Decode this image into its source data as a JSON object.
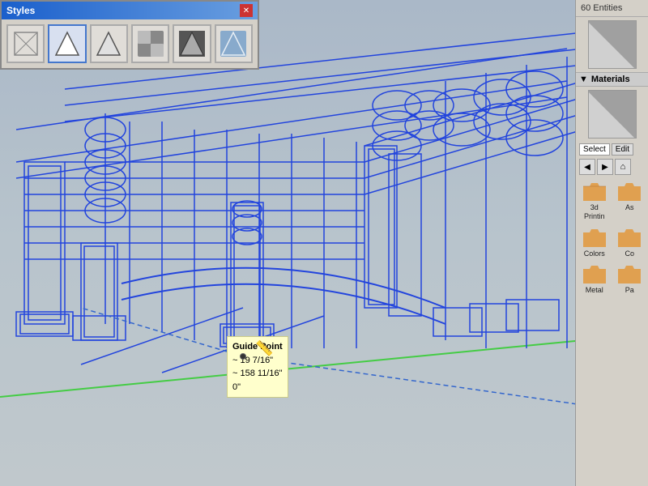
{
  "styles_dialog": {
    "title": "Styles",
    "close_label": "✕",
    "style_buttons": [
      {
        "id": "wireframe",
        "label": "Wireframe",
        "active": false
      },
      {
        "id": "hidden-line",
        "label": "Hidden Line",
        "active": true
      },
      {
        "id": "shaded",
        "label": "Shaded",
        "active": false
      },
      {
        "id": "shaded-textured",
        "label": "Shaded with Textures",
        "active": false
      },
      {
        "id": "monochrome",
        "label": "Monochrome",
        "active": false
      },
      {
        "id": "xray",
        "label": "X-Ray",
        "active": false
      }
    ]
  },
  "right_panel": {
    "entities_label": "60 Entities",
    "materials_header": "Materials",
    "tabs": [
      {
        "id": "select",
        "label": "Select",
        "active": true
      },
      {
        "id": "edit",
        "label": "Edit",
        "active": false
      }
    ],
    "categories": [
      {
        "id": "3d-printing",
        "label": "3d Printin"
      },
      {
        "id": "asphalt",
        "label": "As"
      },
      {
        "id": "colors",
        "label": "Colors"
      },
      {
        "id": "concrete",
        "label": "Co"
      },
      {
        "id": "metal",
        "label": "Metal"
      },
      {
        "id": "paper",
        "label": "Pa"
      }
    ]
  },
  "guide_point": {
    "title": "Guide Point",
    "line1": "~ 19 7/16\"",
    "line2": "~ 158 11/16\"",
    "line3": "0\""
  },
  "viewport": {
    "wireframe_color": "#2244dd"
  }
}
